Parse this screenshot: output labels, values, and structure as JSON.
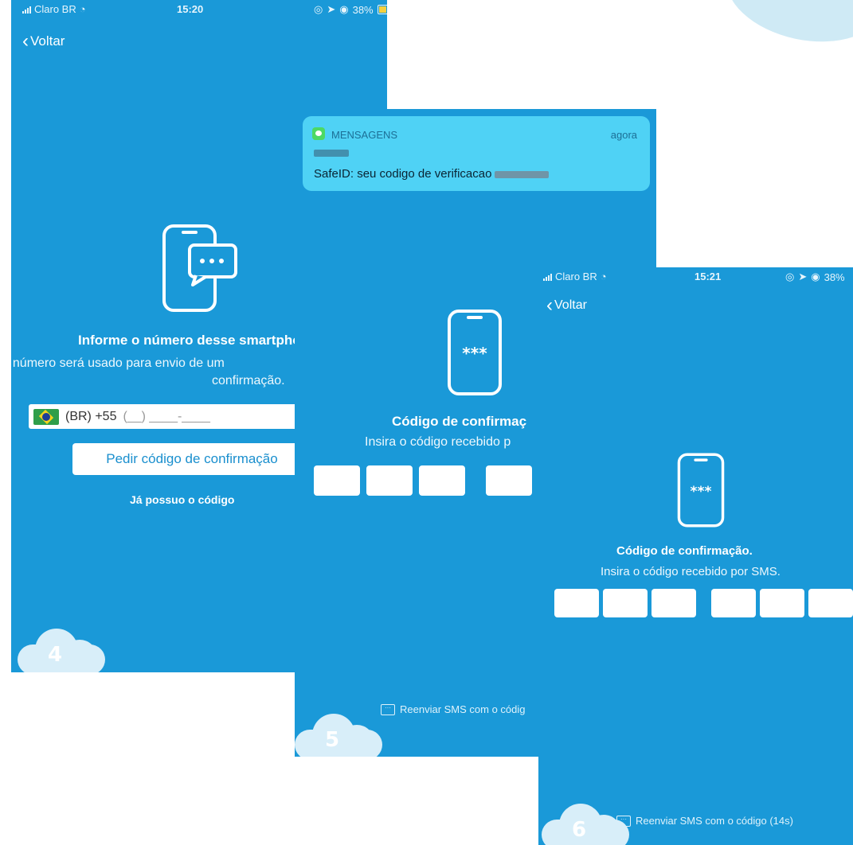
{
  "screen4": {
    "status": {
      "carrier": "Claro BR",
      "time": "15:20",
      "battery": "38%"
    },
    "back_label": "Voltar",
    "title": "Informe o número desse smartpho",
    "subtitle_line1": "O número será usado para envio de um",
    "subtitle_line2": "confirmação.",
    "phone": {
      "country": "(BR) +55",
      "placeholder": "(__) ____-____"
    },
    "request_button": "Pedir código de confirmação",
    "have_code_link": "Já possuo o código",
    "step": "4"
  },
  "screen5": {
    "notification": {
      "app": "MENSAGENS",
      "time": "agora",
      "message": "SafeID: seu codigo de verificacao"
    },
    "title": "Código de confirmaç",
    "subtitle": "Insira o código recebido p",
    "resend": "Reenviar SMS com o códig",
    "step": "5"
  },
  "screen6": {
    "status": {
      "carrier": "Claro BR",
      "time": "15:21",
      "battery": "38%"
    },
    "back_label": "Voltar",
    "title": "Código de confirmação.",
    "subtitle": "Insira o código recebido por SMS.",
    "resend": "Reenviar SMS com o código (14s)",
    "step": "6"
  },
  "colors": {
    "screen_bg": "#1a99d8",
    "accent": "#1a8fce",
    "cloud": "#d8eef9"
  },
  "icons": [
    "phone-chat-icon",
    "phone-code-icon",
    "chevron-left-icon",
    "message-icon",
    "brazil-flag-icon"
  ]
}
